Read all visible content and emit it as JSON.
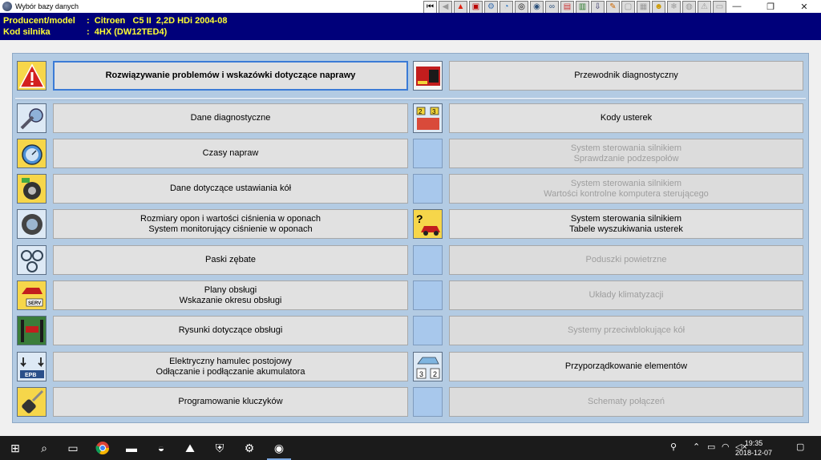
{
  "window": {
    "title": "Wybór bazy danych",
    "controls": [
      "—",
      "❐",
      "✕"
    ]
  },
  "toolbar": {
    "icons": [
      "first-icon",
      "back-icon",
      "warning-icon",
      "guide-icon",
      "tools-icon",
      "timer-icon",
      "wheel-icon",
      "tyre-icon",
      "belt-icon",
      "service-icon",
      "lift-icon",
      "brake-icon",
      "key-icon",
      "engine-icon",
      "codes-icon",
      "airbag-icon",
      "aircon-icon",
      "abs-icon",
      "wiring-icon",
      "location-icon"
    ]
  },
  "header": {
    "model_label": "Producent/model",
    "model_value": ":  Citroen   C5 II  2,2D HDi 2004-08",
    "engine_label": "Kod silnika",
    "engine_value": ":  4HX (DW12TED4)"
  },
  "menu": {
    "left": [
      {
        "lines": [
          "Rozwiązywanie problemów i wskazówki dotyczące naprawy"
        ],
        "icon": "warning-triangle-icon"
      },
      {
        "lines": [
          "Dane diagnostyczne"
        ],
        "icon": "wrench-gauge-icon"
      },
      {
        "lines": [
          "Czasy napraw"
        ],
        "icon": "stopwatch-icon"
      },
      {
        "lines": [
          "Dane dotyczące ustawiania kół"
        ],
        "icon": "wheel-alignment-icon"
      },
      {
        "lines": [
          "Rozmiary opon i wartości ciśnienia w oponach",
          "System monitorujący ciśnienie w oponach"
        ],
        "icon": "tyre-pressure-icon"
      },
      {
        "lines": [
          "Paski zębate"
        ],
        "icon": "timing-belt-icon"
      },
      {
        "lines": [
          "Plany obsługi",
          "Wskazanie okresu obsługi"
        ],
        "icon": "service-schedule-icon"
      },
      {
        "lines": [
          "Rysunki dotyczące obsługi"
        ],
        "icon": "car-lift-icon"
      },
      {
        "lines": [
          "Elektryczny hamulec postojowy",
          "Odłączanie i podłączanie akumulatora"
        ],
        "icon": "epb-icon"
      },
      {
        "lines": [
          "Programowanie kluczyków"
        ],
        "icon": "car-key-icon"
      }
    ],
    "right": [
      {
        "lines": [
          "Przewodnik diagnostyczny"
        ],
        "icon": "diagnostic-guide-icon",
        "enabled": true
      },
      {
        "lines": [
          "Kody usterek"
        ],
        "icon": "fault-codes-icon",
        "enabled": true
      },
      {
        "lines": [
          "System sterowania silnikiem",
          "Sprawdzanie podzespołów"
        ],
        "icon": "empty-icon",
        "enabled": false
      },
      {
        "lines": [
          "System sterowania silnikiem",
          "Wartości kontrolne komputera sterującego"
        ],
        "icon": "empty-icon",
        "enabled": false
      },
      {
        "lines": [
          "System sterowania silnikiem",
          "Tabele wyszukiwania usterek"
        ],
        "icon": "fault-finding-icon",
        "enabled": true
      },
      {
        "lines": [
          "Poduszki powietrzne"
        ],
        "icon": "empty-icon",
        "enabled": false
      },
      {
        "lines": [
          "Układy klimatyzacji"
        ],
        "icon": "empty-icon",
        "enabled": false
      },
      {
        "lines": [
          "Systemy przeciwblokujące kół"
        ],
        "icon": "empty-icon",
        "enabled": false
      },
      {
        "lines": [
          "Przyporządkowanie elementów"
        ],
        "icon": "component-location-icon",
        "enabled": true
      },
      {
        "lines": [
          "Schematy połączeń"
        ],
        "icon": "empty-icon",
        "enabled": false
      }
    ]
  },
  "taskbar": {
    "time": "19:35",
    "date": "2018-12-07"
  },
  "colors": {
    "header_bg": "#00007a",
    "header_text": "#ffff33",
    "panel_bg": "#b3cbe3",
    "focus": "#3b7bd6"
  }
}
